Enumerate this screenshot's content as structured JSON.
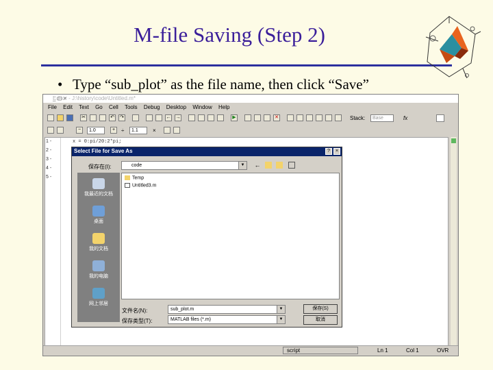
{
  "slide": {
    "title": "M-file Saving (Step 2)",
    "bullet": "Type “sub_plot” as the file name, then click “Save”",
    "bullet_marker": "•"
  },
  "editor": {
    "title": "Editor - J:\\history\\code\\Untitled.m*",
    "window_controls": "_ ◻ ×",
    "menu": [
      "File",
      "Edit",
      "Text",
      "Go",
      "Cell",
      "Tools",
      "Debug",
      "Desktop",
      "Window",
      "Help"
    ],
    "toolbar2": {
      "value1": "1.0",
      "value2": "1.1",
      "mult": "×",
      "divide": "÷"
    },
    "stack_label": "Stack:",
    "stack_value": "Base",
    "fx": "fx",
    "line_numbers": [
      "1 -",
      "2 -",
      "3 -",
      "4 -",
      "5 -"
    ],
    "code_line1": "x = 0:pi/20:2*pi;",
    "status": {
      "script": "script",
      "ln": "Ln 1",
      "col": "Col 1",
      "ovr": "OVR"
    }
  },
  "dialog": {
    "title": "Select File for Save As",
    "help_btn": "?",
    "close_btn": "×",
    "save_in_label": "保存在(I):",
    "save_in_value": "code",
    "places": [
      "我最近的文档",
      "桌面",
      "我的文档",
      "我的电脑",
      "网上邻居"
    ],
    "files": [
      "Temp",
      "Untitled3.m"
    ],
    "filename_label": "文件名(N):",
    "filename_value": "sub_plot.m",
    "filetype_label": "保存类型(T):",
    "filetype_value": "MATLAB files (*.m)",
    "save_label": "保存(S)",
    "cancel_label": "取消"
  },
  "colors": {
    "title_text": "#3a1e9a",
    "rule": "#2b2f9e",
    "dialog_titlebar": "#0a246a",
    "slide_bg": "#fdfbe6"
  }
}
